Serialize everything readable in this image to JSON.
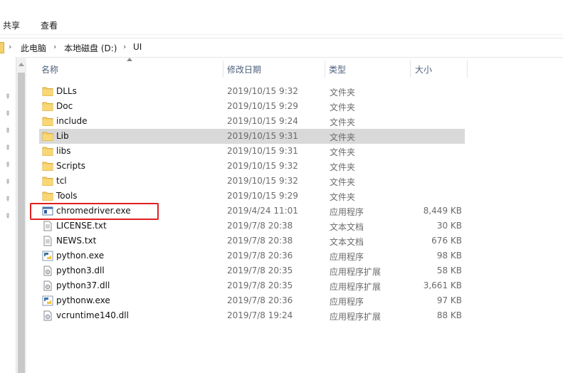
{
  "ribbon": {
    "tab_share": "共享",
    "tab_view": "查看"
  },
  "address": {
    "crumbs": [
      "此电脑",
      "本地磁盘 (D:)",
      "UI"
    ],
    "separators": [
      "›",
      "›",
      "›"
    ]
  },
  "columns": {
    "name": "名称",
    "date": "修改日期",
    "type": "类型",
    "size": "大小"
  },
  "files": [
    {
      "name": "DLLs",
      "date": "2019/10/15 9:32",
      "type": "文件夹",
      "size": "",
      "icon": "folder-icon"
    },
    {
      "name": "Doc",
      "date": "2019/10/15 9:29",
      "type": "文件夹",
      "size": "",
      "icon": "folder-icon"
    },
    {
      "name": "include",
      "date": "2019/10/15 9:24",
      "type": "文件夹",
      "size": "",
      "icon": "folder-icon"
    },
    {
      "name": "Lib",
      "date": "2019/10/15 9:31",
      "type": "文件夹",
      "size": "",
      "icon": "folder-icon",
      "selected": true
    },
    {
      "name": "libs",
      "date": "2019/10/15 9:31",
      "type": "文件夹",
      "size": "",
      "icon": "folder-icon"
    },
    {
      "name": "Scripts",
      "date": "2019/10/15 9:32",
      "type": "文件夹",
      "size": "",
      "icon": "folder-icon"
    },
    {
      "name": "tcl",
      "date": "2019/10/15 9:32",
      "type": "文件夹",
      "size": "",
      "icon": "folder-icon"
    },
    {
      "name": "Tools",
      "date": "2019/10/15 9:29",
      "type": "文件夹",
      "size": "",
      "icon": "folder-icon"
    },
    {
      "name": "chromedriver.exe",
      "date": "2019/4/24 11:01",
      "type": "应用程序",
      "size": "8,449 KB",
      "icon": "exe-icon",
      "highlighted": true
    },
    {
      "name": "LICENSE.txt",
      "date": "2019/7/8 20:38",
      "type": "文本文档",
      "size": "30 KB",
      "icon": "text-file-icon"
    },
    {
      "name": "NEWS.txt",
      "date": "2019/7/8 20:38",
      "type": "文本文档",
      "size": "676 KB",
      "icon": "text-file-icon"
    },
    {
      "name": "python.exe",
      "date": "2019/7/8 20:36",
      "type": "应用程序",
      "size": "98 KB",
      "icon": "python-icon"
    },
    {
      "name": "python3.dll",
      "date": "2019/7/8 20:35",
      "type": "应用程序扩展",
      "size": "58 KB",
      "icon": "dll-icon"
    },
    {
      "name": "python37.dll",
      "date": "2019/7/8 20:35",
      "type": "应用程序扩展",
      "size": "3,661 KB",
      "icon": "dll-icon"
    },
    {
      "name": "pythonw.exe",
      "date": "2019/7/8 20:36",
      "type": "应用程序",
      "size": "97 KB",
      "icon": "python-icon"
    },
    {
      "name": "vcruntime140.dll",
      "date": "2019/7/8 19:24",
      "type": "应用程序扩展",
      "size": "88 KB",
      "icon": "dll-icon"
    }
  ],
  "colors": {
    "selection": "#d9d9d9",
    "highlight_border": "#e02020",
    "folder": "#f5cf6b",
    "header_text": "#4c607a"
  }
}
